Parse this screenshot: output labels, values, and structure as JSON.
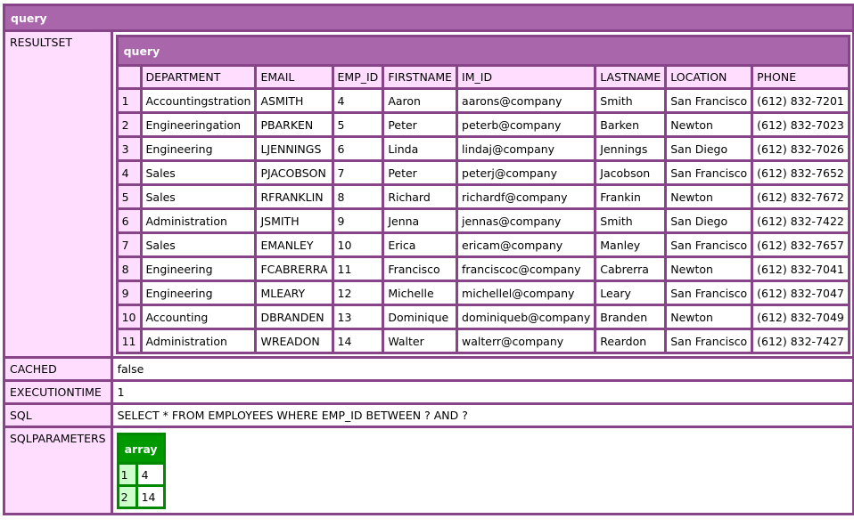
{
  "dump": {
    "title": "query",
    "labels": {
      "resultset": "RESULTSET",
      "cached": "CACHED",
      "executiontime": "EXECUTIONTIME",
      "sql": "SQL",
      "sqlparameters": "SQLPARAMETERS"
    },
    "cached": "false",
    "executiontime": "1",
    "sql": "SELECT * FROM EMPLOYEES WHERE EMP_ID BETWEEN ? AND ?",
    "resultset": {
      "title": "query",
      "columns": [
        "DEPARTMENT",
        "EMAIL",
        "EMP_ID",
        "FIRSTNAME",
        "IM_ID",
        "LASTNAME",
        "LOCATION",
        "PHONE"
      ],
      "rows": [
        [
          "1",
          "Accountingstration",
          "ASMITH",
          "4",
          "Aaron",
          "aarons@company",
          "Smith",
          "San Francisco",
          "(612) 832-7201"
        ],
        [
          "2",
          "Engineeringation",
          "PBARKEN",
          "5",
          "Peter",
          "peterb@company",
          "Barken",
          "Newton",
          "(612) 832-7023"
        ],
        [
          "3",
          "Engineering",
          "LJENNINGS",
          "6",
          "Linda",
          "lindaj@company",
          "Jennings",
          "San Diego",
          "(612) 832-7026"
        ],
        [
          "4",
          "Sales",
          "PJACOBSON",
          "7",
          "Peter",
          "peterj@company",
          "Jacobson",
          "San Francisco",
          "(612) 832-7652"
        ],
        [
          "5",
          "Sales",
          "RFRANKLIN",
          "8",
          "Richard",
          "richardf@company",
          "Frankin",
          "Newton",
          "(612) 832-7672"
        ],
        [
          "6",
          "Administration",
          "JSMITH",
          "9",
          "Jenna",
          "jennas@company",
          "Smith",
          "San Diego",
          "(612) 832-7422"
        ],
        [
          "7",
          "Sales",
          "EMANLEY",
          "10",
          "Erica",
          "ericam@company",
          "Manley",
          "San Francisco",
          "(612) 832-7657"
        ],
        [
          "8",
          "Engineering",
          "FCABRERRA",
          "11",
          "Francisco",
          "franciscoc@company",
          "Cabrerra",
          "Newton",
          "(612) 832-7041"
        ],
        [
          "9",
          "Engineering",
          "MLEARY",
          "12",
          "Michelle",
          "michellel@company",
          "Leary",
          "San Francisco",
          "(612) 832-7047"
        ],
        [
          "10",
          "Accounting",
          "DBRANDEN",
          "13",
          "Dominique",
          "dominiqueb@company",
          "Branden",
          "Newton",
          "(612) 832-7049"
        ],
        [
          "11",
          "Administration",
          "WREADON",
          "14",
          "Walter",
          "walterr@company",
          "Reardon",
          "San Francisco",
          "(612) 832-7427"
        ]
      ]
    },
    "sqlparameters": {
      "title": "array",
      "items": [
        {
          "index": "1",
          "value": "4"
        },
        {
          "index": "2",
          "value": "14"
        }
      ]
    }
  }
}
